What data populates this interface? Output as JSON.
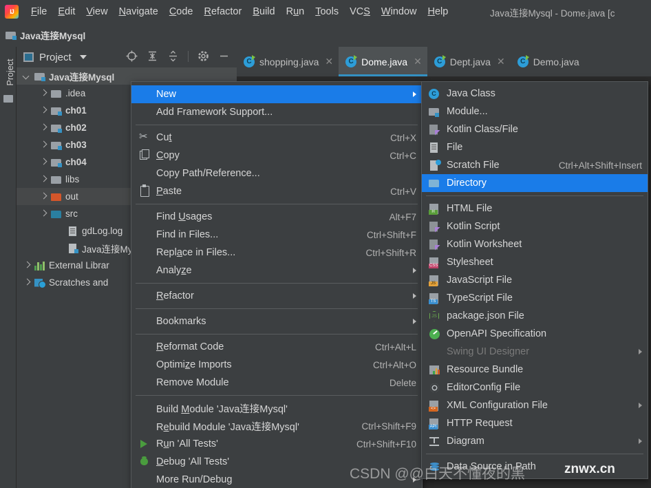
{
  "titlebar": {
    "app_icon": "intellij-logo-icon",
    "menus": [
      {
        "label": "File",
        "mnemonic": "F"
      },
      {
        "label": "Edit",
        "mnemonic": "E"
      },
      {
        "label": "View",
        "mnemonic": "V"
      },
      {
        "label": "Navigate",
        "mnemonic": "N"
      },
      {
        "label": "Code",
        "mnemonic": "C"
      },
      {
        "label": "Refactor",
        "mnemonic": "R"
      },
      {
        "label": "Build",
        "mnemonic": "B"
      },
      {
        "label": "Run",
        "mnemonic": "u"
      },
      {
        "label": "Tools",
        "mnemonic": "T"
      },
      {
        "label": "VCS",
        "mnemonic": "S"
      },
      {
        "label": "Window",
        "mnemonic": "W"
      },
      {
        "label": "Help",
        "mnemonic": "H"
      }
    ],
    "window_title": "Java连接Mysql - Dome.java [c"
  },
  "navbar": {
    "crumb": "Java连接Mysql"
  },
  "toolstrip": {
    "label": "Project",
    "icon": "folder-icon"
  },
  "project_panel": {
    "title": "Project",
    "tools": [
      "locate-icon",
      "expand-all-icon",
      "collapse-all-icon",
      "settings-gear-icon",
      "hide-icon"
    ],
    "tree": [
      {
        "label": "Java连接Mysql",
        "indent": 0,
        "arrow": "down",
        "icon": "module-folder-icon",
        "bold": true,
        "selected": true
      },
      {
        "label": ".idea",
        "indent": 1,
        "arrow": "right",
        "icon": "folder-icon",
        "bold": false,
        "selected": false
      },
      {
        "label": "ch01",
        "indent": 1,
        "arrow": "right",
        "icon": "source-folder-icon",
        "bold": true,
        "selected": false
      },
      {
        "label": "ch02",
        "indent": 1,
        "arrow": "right",
        "icon": "source-folder-icon",
        "bold": true,
        "selected": false
      },
      {
        "label": "ch03",
        "indent": 1,
        "arrow": "right",
        "icon": "source-folder-icon",
        "bold": true,
        "selected": false
      },
      {
        "label": "ch04",
        "indent": 1,
        "arrow": "right",
        "icon": "source-folder-icon",
        "bold": true,
        "selected": false
      },
      {
        "label": "libs",
        "indent": 1,
        "arrow": "right",
        "icon": "folder-icon",
        "bold": false,
        "selected": false
      },
      {
        "label": "out",
        "indent": 1,
        "arrow": "right",
        "icon": "output-folder-icon",
        "bold": false,
        "selected": false,
        "hover": true
      },
      {
        "label": "src",
        "indent": 1,
        "arrow": "right",
        "icon": "sources-root-icon",
        "bold": false,
        "selected": false
      },
      {
        "label": "gdLog.log",
        "indent": 2,
        "arrow": "none",
        "icon": "log-file-icon",
        "bold": false,
        "selected": false
      },
      {
        "label": "Java连接My",
        "indent": 2,
        "arrow": "none",
        "icon": "iml-file-icon",
        "bold": false,
        "selected": false
      },
      {
        "label": "External Librar",
        "indent": 0,
        "arrow": "right",
        "icon": "libraries-icon",
        "bold": false,
        "selected": false
      },
      {
        "label": "Scratches and",
        "indent": 0,
        "arrow": "right",
        "icon": "scratches-icon",
        "bold": false,
        "selected": false
      }
    ]
  },
  "editor_tabs": [
    {
      "label": "shopping.java",
      "icon": "java-class-icon",
      "active": false,
      "closable": true
    },
    {
      "label": "Dome.java",
      "icon": "java-class-icon",
      "active": true,
      "closable": true
    },
    {
      "label": "Dept.java",
      "icon": "java-class-icon",
      "active": false,
      "closable": true
    },
    {
      "label": "Demo.java",
      "icon": "java-class-icon",
      "active": false,
      "closable": false
    }
  ],
  "context_menu": {
    "items": [
      {
        "type": "item",
        "label": "New",
        "mnemonic": "",
        "shortcut": "",
        "icon": "",
        "submenu": true,
        "highlighted": true
      },
      {
        "type": "item",
        "label": "Add Framework Support...",
        "mnemonic": "",
        "shortcut": "",
        "icon": "",
        "submenu": false,
        "highlighted": false
      },
      {
        "type": "separator"
      },
      {
        "type": "item",
        "label": "Cut",
        "mnemonic": "t",
        "shortcut": "Ctrl+X",
        "icon": "cut-icon",
        "submenu": false,
        "highlighted": false
      },
      {
        "type": "item",
        "label": "Copy",
        "mnemonic": "C",
        "shortcut": "Ctrl+C",
        "icon": "copy-icon",
        "submenu": false,
        "highlighted": false
      },
      {
        "type": "item",
        "label": "Copy Path/Reference...",
        "mnemonic": "",
        "shortcut": "",
        "icon": "",
        "submenu": false,
        "highlighted": false
      },
      {
        "type": "item",
        "label": "Paste",
        "mnemonic": "P",
        "shortcut": "Ctrl+V",
        "icon": "paste-icon",
        "submenu": false,
        "highlighted": false
      },
      {
        "type": "separator"
      },
      {
        "type": "item",
        "label": "Find Usages",
        "mnemonic": "U",
        "shortcut": "Alt+F7",
        "icon": "",
        "submenu": false,
        "highlighted": false
      },
      {
        "type": "item",
        "label": "Find in Files...",
        "mnemonic": "",
        "shortcut": "Ctrl+Shift+F",
        "icon": "",
        "submenu": false,
        "highlighted": false
      },
      {
        "type": "item",
        "label": "Replace in Files...",
        "mnemonic": "a",
        "shortcut": "Ctrl+Shift+R",
        "icon": "",
        "submenu": false,
        "highlighted": false
      },
      {
        "type": "item",
        "label": "Analyze",
        "mnemonic": "z",
        "shortcut": "",
        "icon": "",
        "submenu": true,
        "highlighted": false
      },
      {
        "type": "separator"
      },
      {
        "type": "item",
        "label": "Refactor",
        "mnemonic": "R",
        "shortcut": "",
        "icon": "",
        "submenu": true,
        "highlighted": false
      },
      {
        "type": "separator"
      },
      {
        "type": "item",
        "label": "Bookmarks",
        "mnemonic": "",
        "shortcut": "",
        "icon": "",
        "submenu": true,
        "highlighted": false
      },
      {
        "type": "separator"
      },
      {
        "type": "item",
        "label": "Reformat Code",
        "mnemonic": "R",
        "shortcut": "Ctrl+Alt+L",
        "icon": "",
        "submenu": false,
        "highlighted": false
      },
      {
        "type": "item",
        "label": "Optimize Imports",
        "mnemonic": "z",
        "shortcut": "Ctrl+Alt+O",
        "icon": "",
        "submenu": false,
        "highlighted": false
      },
      {
        "type": "item",
        "label": "Remove Module",
        "mnemonic": "",
        "shortcut": "Delete",
        "icon": "",
        "submenu": false,
        "highlighted": false
      },
      {
        "type": "separator"
      },
      {
        "type": "item",
        "label": "Build Module 'Java连接Mysql'",
        "mnemonic": "M",
        "shortcut": "",
        "icon": "",
        "submenu": false,
        "highlighted": false
      },
      {
        "type": "item",
        "label": "Rebuild Module 'Java连接Mysql'",
        "mnemonic": "e",
        "shortcut": "Ctrl+Shift+F9",
        "icon": "",
        "submenu": false,
        "highlighted": false
      },
      {
        "type": "item",
        "label": "Run 'All Tests'",
        "mnemonic": "u",
        "shortcut": "Ctrl+Shift+F10",
        "icon": "run-icon",
        "submenu": false,
        "highlighted": false
      },
      {
        "type": "item",
        "label": "Debug 'All Tests'",
        "mnemonic": "D",
        "shortcut": "",
        "icon": "debug-icon",
        "submenu": false,
        "highlighted": false
      },
      {
        "type": "item",
        "label": "More Run/Debug",
        "mnemonic": "",
        "shortcut": "",
        "icon": "",
        "submenu": true,
        "highlighted": false
      }
    ]
  },
  "new_submenu": {
    "items": [
      {
        "type": "item",
        "label": "Java Class",
        "shortcut": "",
        "icon": "java-class-icon",
        "submenu": false,
        "highlighted": false,
        "disabled": false
      },
      {
        "type": "item",
        "label": "Module...",
        "shortcut": "",
        "icon": "module-icon",
        "submenu": false,
        "highlighted": false,
        "disabled": false
      },
      {
        "type": "item",
        "label": "Kotlin Class/File",
        "shortcut": "",
        "icon": "kotlin-icon",
        "submenu": false,
        "highlighted": false,
        "disabled": false
      },
      {
        "type": "item",
        "label": "File",
        "shortcut": "",
        "icon": "file-icon",
        "submenu": false,
        "highlighted": false,
        "disabled": false
      },
      {
        "type": "item",
        "label": "Scratch File",
        "shortcut": "Ctrl+Alt+Shift+Insert",
        "icon": "scratch-file-icon",
        "submenu": false,
        "highlighted": false,
        "disabled": false
      },
      {
        "type": "item",
        "label": "Directory",
        "shortcut": "",
        "icon": "directory-icon",
        "submenu": false,
        "highlighted": true,
        "disabled": false
      },
      {
        "type": "separator"
      },
      {
        "type": "item",
        "label": "HTML File",
        "shortcut": "",
        "icon": "html-file-icon",
        "submenu": false,
        "highlighted": false,
        "disabled": false
      },
      {
        "type": "item",
        "label": "Kotlin Script",
        "shortcut": "",
        "icon": "kotlin-icon",
        "submenu": false,
        "highlighted": false,
        "disabled": false
      },
      {
        "type": "item",
        "label": "Kotlin Worksheet",
        "shortcut": "",
        "icon": "kotlin-icon",
        "submenu": false,
        "highlighted": false,
        "disabled": false
      },
      {
        "type": "item",
        "label": "Stylesheet",
        "shortcut": "",
        "icon": "css-file-icon",
        "submenu": false,
        "highlighted": false,
        "disabled": false
      },
      {
        "type": "item",
        "label": "JavaScript File",
        "shortcut": "",
        "icon": "js-file-icon",
        "submenu": false,
        "highlighted": false,
        "disabled": false
      },
      {
        "type": "item",
        "label": "TypeScript File",
        "shortcut": "",
        "icon": "ts-file-icon",
        "submenu": false,
        "highlighted": false,
        "disabled": false
      },
      {
        "type": "item",
        "label": "package.json File",
        "shortcut": "",
        "icon": "nodejs-icon",
        "submenu": false,
        "highlighted": false,
        "disabled": false
      },
      {
        "type": "item",
        "label": "OpenAPI Specification",
        "shortcut": "",
        "icon": "openapi-icon",
        "submenu": false,
        "highlighted": false,
        "disabled": false
      },
      {
        "type": "item",
        "label": "Swing UI Designer",
        "shortcut": "",
        "icon": "",
        "submenu": true,
        "highlighted": false,
        "disabled": true
      },
      {
        "type": "item",
        "label": "Resource Bundle",
        "shortcut": "",
        "icon": "resource-bundle-icon",
        "submenu": false,
        "highlighted": false,
        "disabled": false
      },
      {
        "type": "item",
        "label": "EditorConfig File",
        "shortcut": "",
        "icon": "editorconfig-icon",
        "submenu": false,
        "highlighted": false,
        "disabled": false
      },
      {
        "type": "item",
        "label": "XML Configuration File",
        "shortcut": "",
        "icon": "xml-file-icon",
        "submenu": true,
        "highlighted": false,
        "disabled": false
      },
      {
        "type": "item",
        "label": "HTTP Request",
        "shortcut": "",
        "icon": "http-request-icon",
        "submenu": false,
        "highlighted": false,
        "disabled": false
      },
      {
        "type": "item",
        "label": "Diagram",
        "shortcut": "",
        "icon": "diagram-icon",
        "submenu": true,
        "highlighted": false,
        "disabled": false
      },
      {
        "type": "separator"
      },
      {
        "type": "item",
        "label": "Data Source in Path",
        "shortcut": "",
        "icon": "database-icon",
        "submenu": false,
        "highlighted": false,
        "disabled": false
      }
    ]
  },
  "watermark": {
    "csdn": "CSDN @@白天不懂夜的黑",
    "site": "znwx.cn"
  },
  "colors": {
    "highlight_blue": "#1a7ce8",
    "panel_bg": "#3c3f41",
    "editor_bg": "#2b2b2b",
    "menu_border": "#565a5c",
    "text": "#d6d6d6",
    "accent_tab": "#3592c4"
  }
}
